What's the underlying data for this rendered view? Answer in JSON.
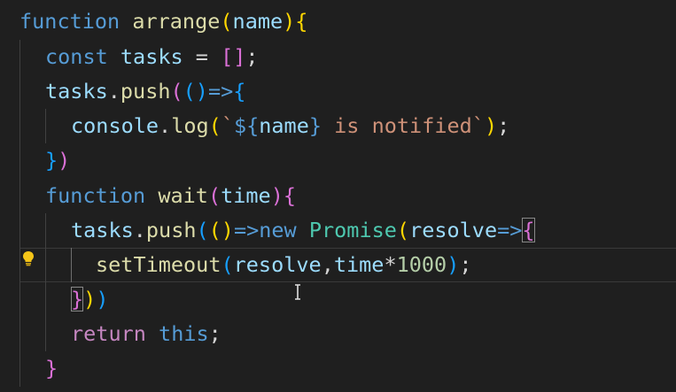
{
  "code": {
    "line1": {
      "kw": "function",
      "name": "arrange",
      "p1": "(",
      "param": "name",
      "p2": ")",
      "br": "{"
    },
    "line2": {
      "kw": "const",
      "var": "tasks",
      "op": " = ",
      "br": "[]",
      "semi": ";"
    },
    "line3": {
      "obj": "tasks",
      "dot": ".",
      "fn": "push",
      "p1": "(",
      "p2": "()",
      "arrow": "=>",
      "br": "{"
    },
    "line4": {
      "obj": "console",
      "dot": ".",
      "fn": "log",
      "p1": "(",
      "tick1": "`",
      "tpl_open": "${",
      "var": "name",
      "tpl_close": "}",
      "str": " is notified",
      "tick2": "`",
      "p2": ")",
      "semi": ";"
    },
    "line5": {
      "br": "}",
      "p": ")"
    },
    "line6": {
      "kw": "function",
      "name": "wait",
      "p1": "(",
      "param": "time",
      "p2": ")",
      "br": "{"
    },
    "line7": {
      "obj": "tasks",
      "dot": ".",
      "fn": "push",
      "p1": "(",
      "p2": "()",
      "arrow": "=>",
      "kw": "new",
      "cls": "Promise",
      "p3": "(",
      "param": "resolve",
      "arrow2": "=>",
      "br": "{"
    },
    "line8": {
      "fn": "setTimeout",
      "p1": "(",
      "a1": "resolve",
      "comma": ",",
      "a2": "time",
      "mul": "*",
      "num": "1000",
      "p2": ")",
      "semi": ";"
    },
    "line9": {
      "br": "}",
      "p1": ")",
      "p2": ")"
    },
    "line10": {
      "kw": "return",
      "this": "this",
      "semi": ";"
    },
    "line11": {
      "br": "}"
    }
  },
  "icons": {
    "bulb": "lightbulb-icon",
    "cursor": "text-cursor-icon"
  },
  "colors": {
    "background": "#1f1f1f",
    "keyword": "#569cd6",
    "function": "#dcdcaa",
    "variable": "#9cdcfe",
    "string": "#ce9178",
    "number": "#b5cea8",
    "bracket_gold": "#ffd700",
    "bracket_pink": "#da70d6",
    "bracket_blue": "#179fff"
  }
}
